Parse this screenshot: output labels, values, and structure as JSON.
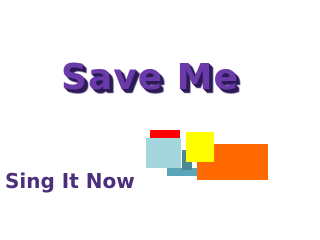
{
  "title": "Save Me",
  "subtitle": "Sing It Now",
  "blocks": [
    {
      "name": "red-square",
      "color": "#ff0000"
    },
    {
      "name": "dark-teal-bar",
      "color": "#5aa6b8"
    },
    {
      "name": "aqua-square",
      "color": "#a3d6dd"
    },
    {
      "name": "slate-square",
      "color": "#4e8794"
    },
    {
      "name": "yellow-square",
      "color": "#ffff00"
    },
    {
      "name": "orange-rectangle",
      "color": "#ff6a00"
    }
  ]
}
